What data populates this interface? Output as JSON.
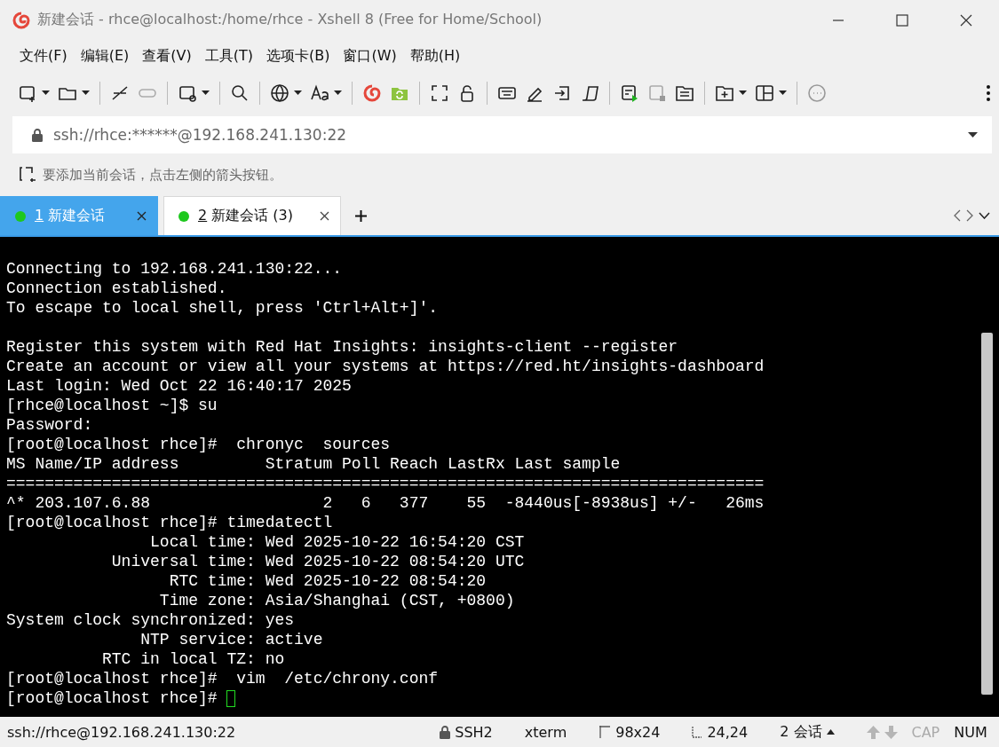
{
  "window": {
    "title": "新建会话 - rhce@localhost:/home/rhce - Xshell 8 (Free for Home/School)"
  },
  "menu": [
    "文件(F)",
    "编辑(E)",
    "查看(V)",
    "工具(T)",
    "选项卡(B)",
    "窗口(W)",
    "帮助(H)"
  ],
  "address_bar": {
    "value": "ssh://rhce:******@192.168.241.130:22"
  },
  "hint_bar": {
    "text": "要添加当前会话，点击左侧的箭头按钮。"
  },
  "tabs": [
    {
      "number": "1",
      "label": "新建会话",
      "selected": true
    },
    {
      "number": "2",
      "label": "新建会话 (3)",
      "selected": false
    }
  ],
  "terminal": {
    "lines": [
      "Connecting to 192.168.241.130:22...",
      "Connection established.",
      "To escape to local shell, press 'Ctrl+Alt+]'.",
      "Register this system with Red Hat Insights: insights-client --register",
      "Create an account or view all your systems at https://red.ht/insights-dashboard",
      "Last login: Wed Oct 22 16:40:17 2025",
      "[rhce@localhost ~]$ su",
      "Password: ",
      "[root@localhost rhce]#  chronyc  sources",
      "MS Name/IP address         Stratum Poll Reach LastRx Last sample",
      "===============================================================================",
      "^* 203.107.6.88                  2   6   377    55  -8440us[-8938us] +/-   26ms",
      "[root@localhost rhce]# timedatectl",
      "               Local time: Wed 2025-10-22 16:54:20 CST",
      "           Universal time: Wed 2025-10-22 08:54:20 UTC",
      "                 RTC time: Wed 2025-10-22 08:54:20",
      "                Time zone: Asia/Shanghai (CST, +0800)",
      "System clock synchronized: yes",
      "              NTP service: active",
      "          RTC in local TZ: no",
      "[root@localhost rhce]#  vim  /etc/chrony.conf",
      "[root@localhost rhce]# "
    ],
    "cursor": true
  },
  "status_bar": [
    {
      "kind": "text",
      "text": "ssh://rhce@192.168.241.130:22",
      "disabled": false
    },
    {
      "kind": "lock",
      "text": "SSH2",
      "disabled": false
    },
    {
      "kind": "text",
      "text": "xterm",
      "disabled": false
    },
    {
      "kind": "size",
      "text": "98x24",
      "disabled": false
    },
    {
      "kind": "cursor",
      "text": "24,24",
      "disabled": false
    },
    {
      "kind": "sessions",
      "text": "2 会话",
      "disabled": false
    },
    {
      "kind": "arrows",
      "disabled": true
    },
    {
      "kind": "text",
      "text": "CAP",
      "disabled": true
    },
    {
      "kind": "text",
      "text": "NUM",
      "disabled": false
    }
  ]
}
